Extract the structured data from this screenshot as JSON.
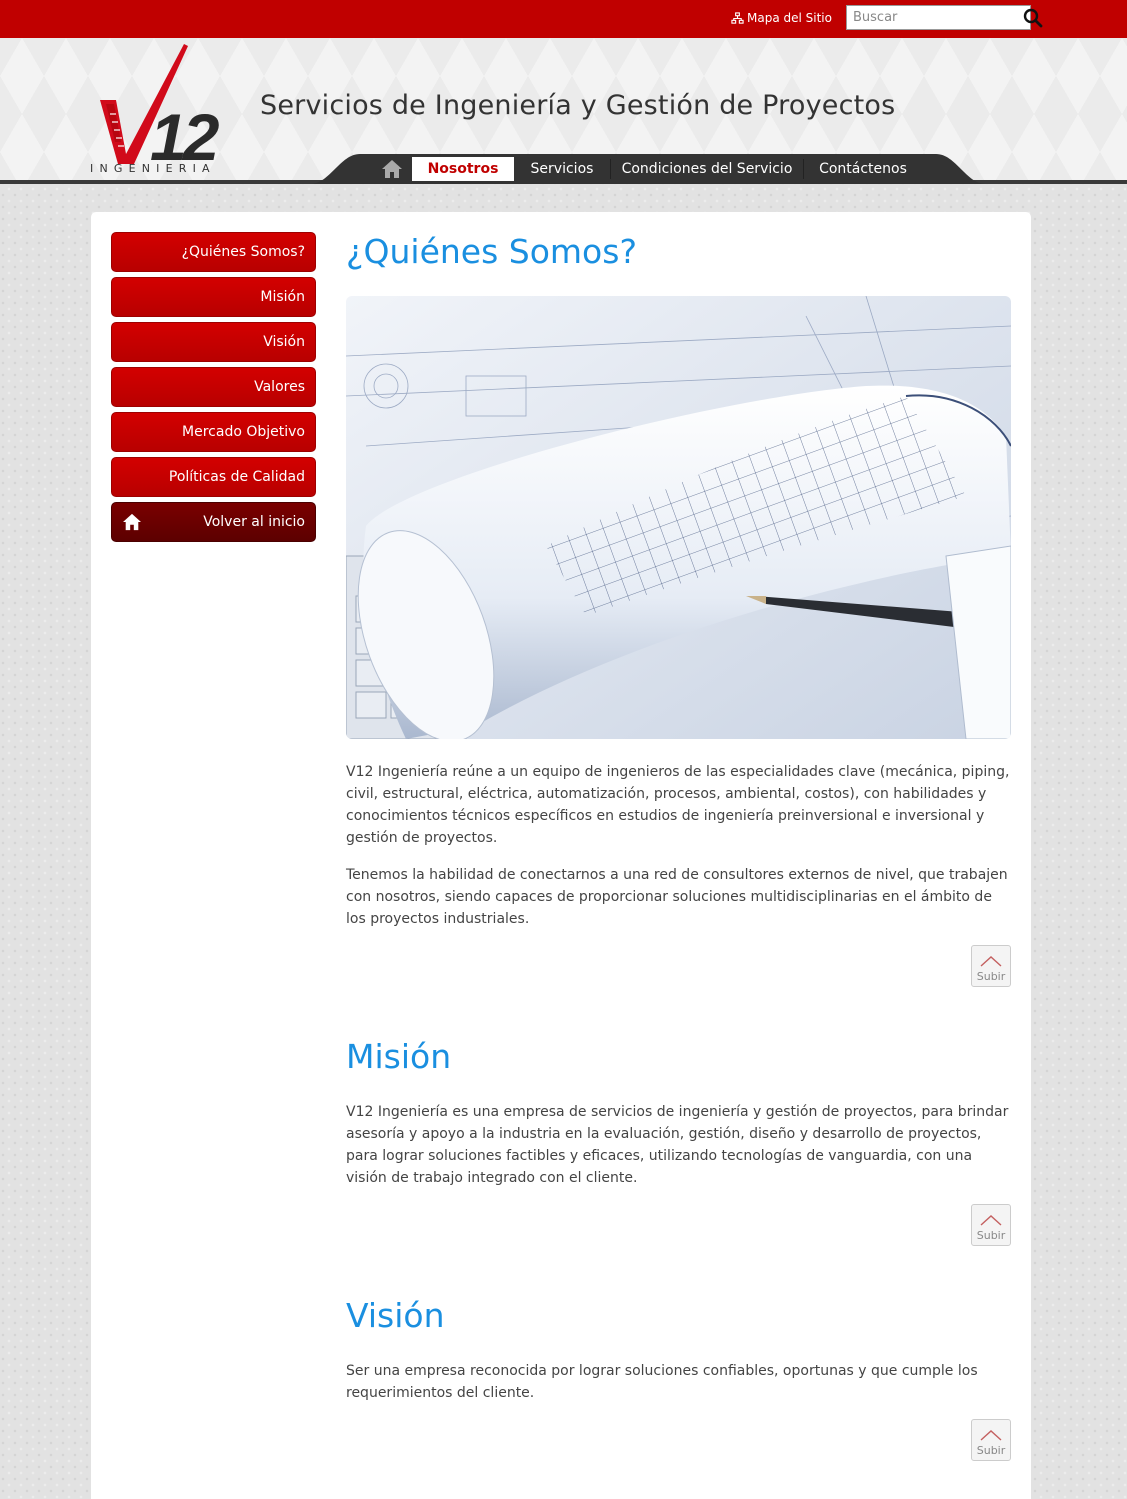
{
  "topbar": {
    "sitemap_label": "Mapa del Sitio",
    "search_placeholder": "Buscar"
  },
  "brand": {
    "logo_text": "V12",
    "logo_caption": "INGENIERIA",
    "tagline": "Servicios de Ingeniería y Gestión de Proyectos"
  },
  "nav": {
    "items": [
      {
        "label": "Nosotros"
      },
      {
        "label": "Servicios"
      },
      {
        "label": "Condiciones del Servicio"
      },
      {
        "label": "Contáctenos"
      }
    ]
  },
  "sidebar": {
    "items": [
      {
        "label": "¿Quiénes Somos?"
      },
      {
        "label": "Misión"
      },
      {
        "label": "Visión"
      },
      {
        "label": "Valores"
      },
      {
        "label": "Mercado Objetivo"
      },
      {
        "label": "Políticas de Calidad"
      }
    ],
    "home_label": "Volver al inicio"
  },
  "sections": {
    "quienes": {
      "title": "¿Quiénes Somos?",
      "p1": "V12 Ingeniería reúne a un equipo de ingenieros de las especialidades clave (mecánica, piping, civil, estructural, eléctrica, automatización, procesos, ambiental, costos), con habilidades y conocimientos técnicos específicos en estudios de ingeniería preinversional e inversional y gestión de proyectos.",
      "p2": "Tenemos la habilidad de conectarnos a una red de consultores externos de nivel, que trabajen con nosotros, siendo capaces de proporcionar soluciones multidisciplinarias en el ámbito de los proyectos industriales."
    },
    "mision": {
      "title": "Misión",
      "p1": "V12 Ingeniería es una empresa de servicios de ingeniería y gestión de proyectos, para brindar asesoría y apoyo a la industria en la evaluación, gestión, diseño y desarrollo de proyectos, para lograr soluciones factibles y eficaces, utilizando tecnologías de vanguardia, con una visión de trabajo integrado con el cliente."
    },
    "vision": {
      "title": "Visión",
      "p1": "Ser una empresa reconocida por lograr soluciones confiables, oportunas y que cumple los requerimientos del cliente."
    }
  },
  "subir_label": "Subir",
  "colors": {
    "brand_red": "#c00000",
    "heading_blue": "#1a8fe0",
    "nav_dark": "#333333"
  },
  "icons": {
    "sitemap": "sitemap-icon",
    "search": "search-icon",
    "home": "home-icon",
    "up": "chevron-up-icon"
  }
}
